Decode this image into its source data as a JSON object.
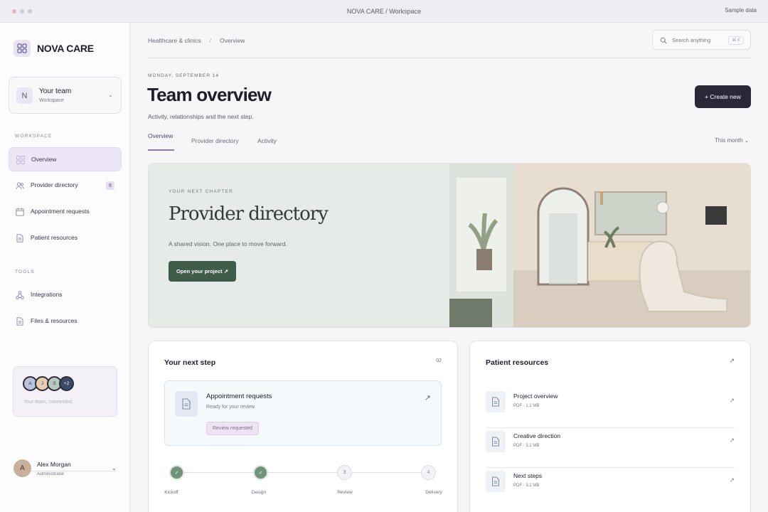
{
  "window": {
    "title": "NOVA CARE / Workspace",
    "right_label": "Sample data"
  },
  "brand": {
    "name": "NOVA CARE"
  },
  "team": {
    "initial": "N",
    "name": "Your team",
    "sub": "Workspace"
  },
  "sidebar": {
    "workspace_label": "WORKSPACE",
    "tools_label": "TOOLS",
    "items": [
      {
        "label": "Overview",
        "icon": "grid-icon"
      },
      {
        "label": "Provider directory",
        "icon": "users-icon",
        "badge": "8"
      },
      {
        "label": "Appointment requests",
        "icon": "calendar-icon"
      },
      {
        "label": "Patient resources",
        "icon": "document-icon"
      }
    ],
    "tools": [
      {
        "label": "Integrations",
        "icon": "integrations-icon"
      },
      {
        "label": "Files & resources",
        "icon": "file-icon"
      }
    ],
    "team_card": {
      "avatars": [
        "A",
        "J",
        "S",
        "+2"
      ],
      "text": "Your team, connected."
    }
  },
  "user": {
    "initial": "A",
    "name": "Alex Morgan",
    "role": "Administrator"
  },
  "breadcrumb": {
    "first": "Healthcare & clinics",
    "sep": "/",
    "second": "Overview"
  },
  "search": {
    "placeholder": "Search anything",
    "shortcut": "⌘ K"
  },
  "header": {
    "date": "MONDAY, SEPTEMBER 14",
    "title": "Team overview",
    "subtitle": "Activity, relationships and the next step.",
    "create_label": "+ Create new"
  },
  "tabs": [
    "Overview",
    "Provider directory",
    "Activity"
  ],
  "period": "This month ⌄",
  "hero": {
    "eyebrow": "YOUR NEXT CHAPTER",
    "title": "Provider directory",
    "subtitle": "A shared vision. One place to move forward.",
    "button": "Open your project ↗"
  },
  "next_step": {
    "title": "Your next step",
    "count": "02",
    "task": {
      "title": "Appointment requests",
      "sub": "Ready for your review",
      "badge": "Review requested"
    },
    "steps": [
      {
        "label": "Kickoff",
        "mark": "✓",
        "done": true
      },
      {
        "label": "Design",
        "mark": "✓",
        "done": true
      },
      {
        "label": "Review",
        "mark": "3",
        "done": false
      },
      {
        "label": "Delivery",
        "mark": "4",
        "done": false
      }
    ]
  },
  "resources": {
    "title": "Patient resources",
    "items": [
      {
        "title": "Project overview",
        "meta": "PDF · 1.2 MB"
      },
      {
        "title": "Creative direction",
        "meta": "PDF · 2.2 MB"
      },
      {
        "title": "Next steps",
        "meta": "PDF · 3.2 MB"
      }
    ]
  },
  "colors": {
    "accent": "#8c7aae",
    "primary_button": "#2a2736",
    "hero_button": "#3f5c48",
    "step_done": "#6f9478"
  }
}
